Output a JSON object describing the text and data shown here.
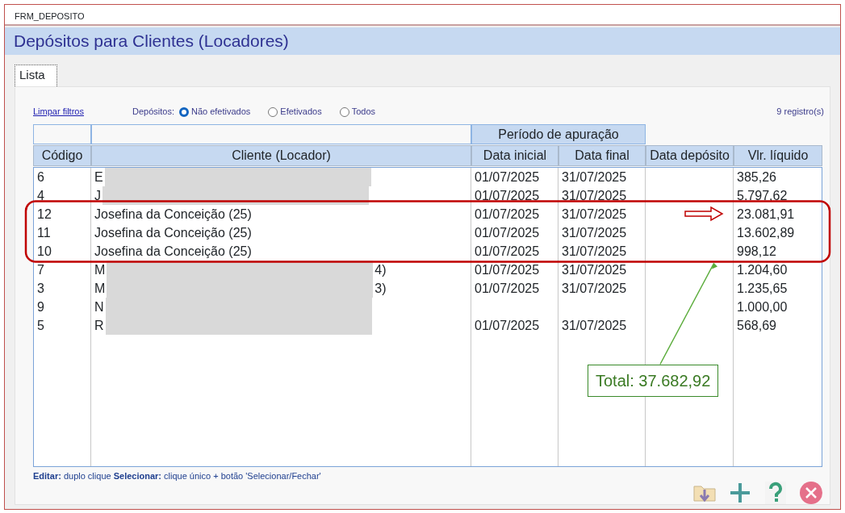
{
  "window": {
    "title": "FRM_DEPOSITO"
  },
  "header": {
    "title": "Depósitos para Clientes (Locadores)"
  },
  "tabs": [
    {
      "label": "Lista",
      "selected": true
    }
  ],
  "filters": {
    "clear_link": "Limpar filtros",
    "label": "Depósitos:",
    "options": [
      {
        "label": "Não efetivados",
        "selected": true
      },
      {
        "label": "Efetivados",
        "selected": false
      },
      {
        "label": "Todos",
        "selected": false
      }
    ],
    "record_count": "9 registro(s)"
  },
  "table": {
    "group_header": "Período de apuração",
    "columns": [
      "Código",
      "Cliente (Locador)",
      "Data inicial",
      "Data final",
      "Data depósito",
      "Vlr. líquido"
    ],
    "rows": [
      {
        "code": "6",
        "client": "E",
        "client_redacted": true,
        "start": "01/07/2025",
        "end": "31/07/2025",
        "net": "385,26",
        "highlighted": false
      },
      {
        "code": "4",
        "client": "J",
        "client_redacted": true,
        "start": "01/07/2025",
        "end": "31/07/2025",
        "net": "5.797,62",
        "highlighted": false
      },
      {
        "code": "12",
        "client": "Josefina da Conceição (25)",
        "client_redacted": false,
        "start": "01/07/2025",
        "end": "31/07/2025",
        "net": "23.081,91",
        "highlighted": true
      },
      {
        "code": "11",
        "client": "Josefina da Conceição (25)",
        "client_redacted": false,
        "start": "01/07/2025",
        "end": "31/07/2025",
        "net": "13.602,89",
        "highlighted": true
      },
      {
        "code": "10",
        "client": "Josefina da Conceição (25)",
        "client_redacted": false,
        "start": "01/07/2025",
        "end": "31/07/2025",
        "net": "998,12",
        "highlighted": true
      },
      {
        "code": "7",
        "client": "M",
        "client_tail": "4)",
        "client_redacted": true,
        "start": "01/07/2025",
        "end": "31/07/2025",
        "net": "1.204,60",
        "highlighted": false
      },
      {
        "code": "3",
        "client": "M",
        "client_tail": "3)",
        "client_redacted": true,
        "start": "01/07/2025",
        "end": "31/07/2025",
        "net": "1.235,65",
        "highlighted": false
      },
      {
        "code": "9",
        "client": "N",
        "client_redacted": true,
        "net": "1.000,00",
        "highlighted": false
      },
      {
        "code": "5",
        "client": "R",
        "client_redacted": true,
        "start": "01/07/2025",
        "end": "31/07/2025",
        "net": "568,69",
        "highlighted": false
      }
    ]
  },
  "annotation": {
    "callout": "Total: 37.682,92"
  },
  "footer_hint": "**Editar:** duplo clique  **Selecionar:** clique único + botão 'Selecionar/Fechar'"
}
